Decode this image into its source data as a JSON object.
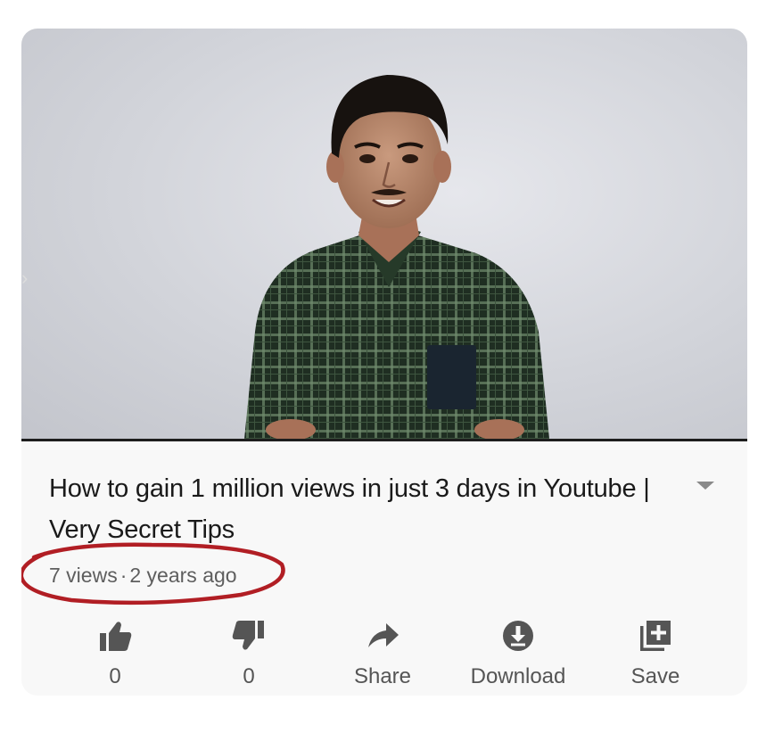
{
  "video": {
    "title": "How to gain 1 million views in just 3 days in Youtube | Very Secret Tips",
    "views": "7 views",
    "separator": "·",
    "age": "2 years ago",
    "menu_icon": "chevron-down-icon"
  },
  "actions": [
    {
      "label": "0",
      "icon": "thumbs-up-icon"
    },
    {
      "label": "0",
      "icon": "thumbs-down-icon"
    },
    {
      "label": "Share",
      "icon": "share-arrow-icon"
    },
    {
      "label": "Download",
      "icon": "download-icon"
    },
    {
      "label": "Save",
      "icon": "add-to-playlist-icon"
    }
  ],
  "colors": {
    "annotation_circle": "#b11e24",
    "text_primary": "#1a1a1a",
    "text_secondary": "#5e5e5e",
    "icon": "#555555",
    "shirt": "#2b3d2b"
  }
}
